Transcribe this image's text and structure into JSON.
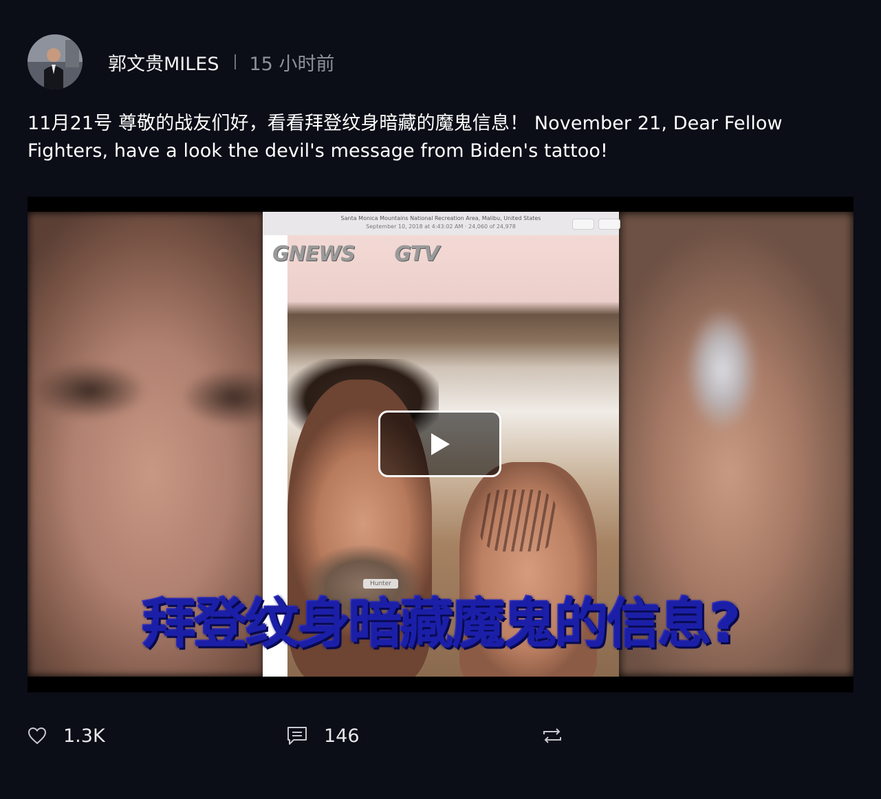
{
  "post": {
    "author": "郭文贵MILES",
    "time": "15 小时前",
    "text": "11月21号 尊敬的战友们好，看看拜登纹身暗藏的魔鬼信息！ November 21, Dear Fellow Fighters, have a look the devil's message from Biden's tattoo!"
  },
  "video": {
    "location_line1": "Santa Monica Mountains National Recreation Area, Malibu, United States",
    "location_line2": "September 10, 2018 at 4:43:02 AM · 24,060 of 24,978",
    "logo_news": "NEWS",
    "logo_tv": "TV",
    "person_label": "Hunter",
    "caption": "拜登纹身暗藏魔鬼的信息?"
  },
  "actions": {
    "likes": "1.3K",
    "comments": "146"
  },
  "colors": {
    "background": "#0b0d17",
    "caption": "#1b1fa8"
  },
  "icons": {
    "like": "heart-icon",
    "comment": "comment-icon",
    "repost": "repost-icon",
    "play": "play-icon"
  }
}
